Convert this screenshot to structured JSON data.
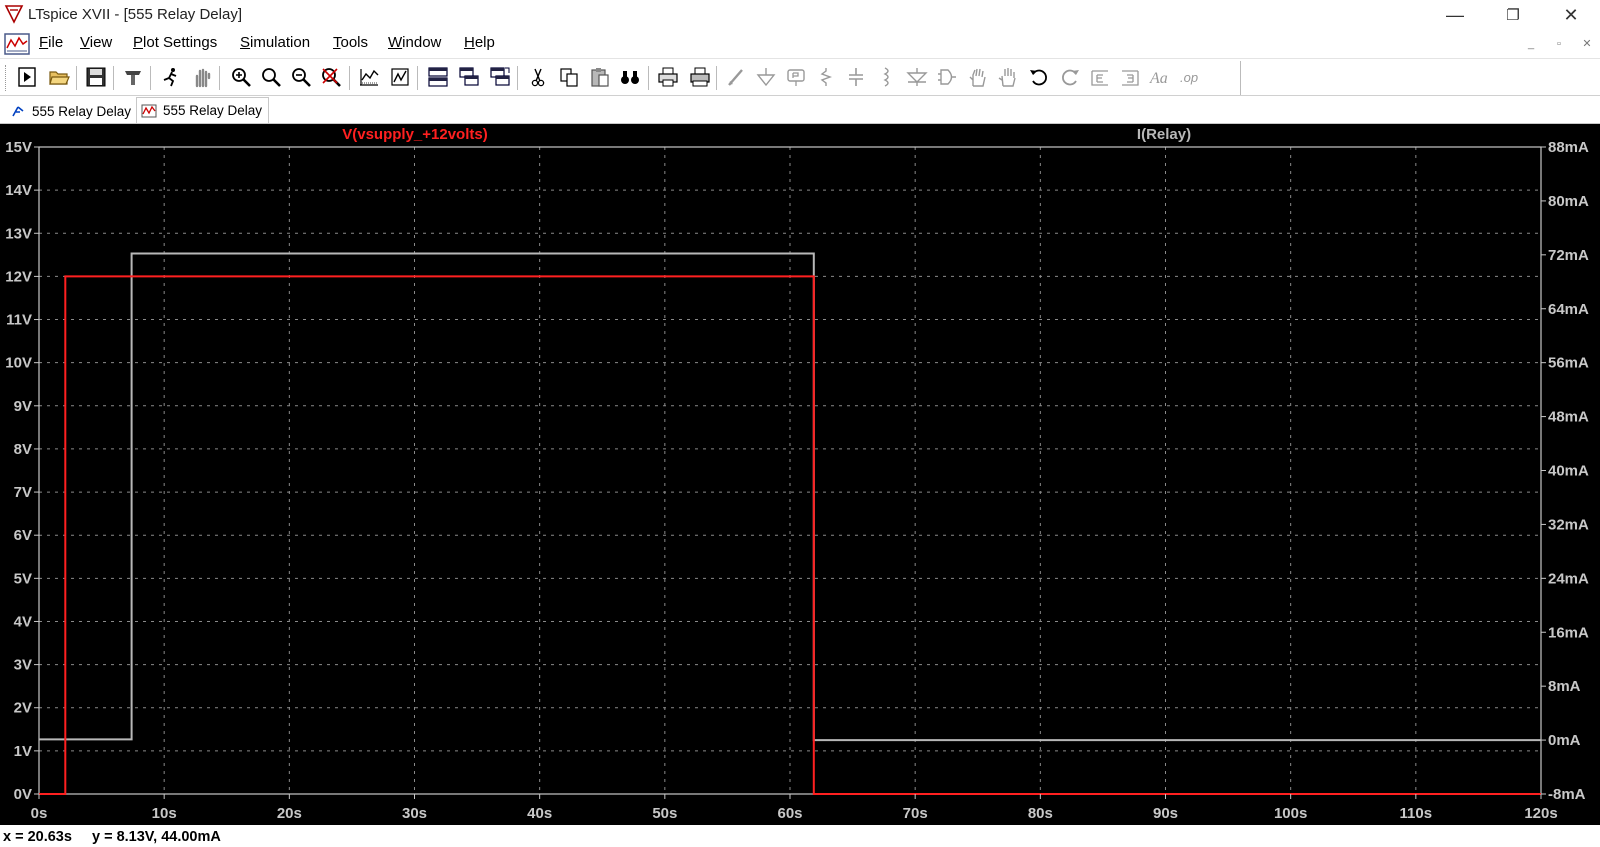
{
  "window": {
    "title": "LTspice XVII - [555 Relay Delay]",
    "controls": {
      "minimize": "—",
      "restore": "❐",
      "close": "✕"
    },
    "app_icon": "ltspice-logo-icon"
  },
  "menu": {
    "items": [
      {
        "label": "File",
        "accel": "F",
        "rest": "ile"
      },
      {
        "label": "View",
        "accel": "V",
        "rest": "iew"
      },
      {
        "label": "Plot Settings",
        "accel": "P",
        "rest": "lot Settings"
      },
      {
        "label": "Simulation",
        "accel": "S",
        "rest": "imulation"
      },
      {
        "label": "Tools",
        "accel": "T",
        "rest": "ools"
      },
      {
        "label": "Window",
        "accel": "W",
        "rest": "indow"
      },
      {
        "label": "Help",
        "accel": "H",
        "rest": "elp"
      }
    ],
    "mdi_controls": {
      "minimize": "_",
      "restore": "▫",
      "close": "✕"
    }
  },
  "toolbar": {
    "buttons": [
      "new-schematic-icon",
      "open-icon",
      "save-icon",
      "control-panel-icon",
      "run-icon",
      "halt-icon",
      "zoom-in-icon",
      "zoom-fit-icon",
      "zoom-out-icon",
      "zoom-cancel-icon",
      "autorange-icon",
      "grid-icon",
      "tile-horizontal-icon",
      "cascade-icon",
      "tile-vertical-icon",
      "cut-icon",
      "copy-icon",
      "paste-icon",
      "find-icon",
      "print-icon",
      "print-setup-icon",
      "wire-icon",
      "ground-icon",
      "label-icon",
      "resistor-icon",
      "capacitor-icon",
      "inductor-icon",
      "diode-icon",
      "component-icon",
      "move-icon",
      "drag-icon",
      "undo-icon",
      "redo-icon",
      "rotate-icon",
      "mirror-icon",
      "text-icon",
      "spice-directive-icon"
    ]
  },
  "tabs": [
    {
      "label": "555 Relay Delay",
      "icon": "schematic-icon",
      "active": false
    },
    {
      "label": "555 Relay Delay",
      "icon": "waveform-icon",
      "active": true
    }
  ],
  "plot": {
    "trace_labels": {
      "left": "V(vsupply_+12volts)",
      "right": "I(Relay)"
    },
    "colors": {
      "background": "#000000",
      "grid": "#8a8a8a",
      "axis_text": "#c8c8c8",
      "trace_voltage": "#ff2020",
      "trace_current": "#b8b8b8",
      "label_left": "#ff2020",
      "label_right": "#b8b8b8"
    }
  },
  "chart_data": {
    "type": "line",
    "x_axis": {
      "label": "",
      "range": [
        0,
        120
      ],
      "unit": "s",
      "ticks": [
        "0s",
        "10s",
        "20s",
        "30s",
        "40s",
        "50s",
        "60s",
        "70s",
        "80s",
        "90s",
        "100s",
        "110s",
        "120s"
      ]
    },
    "y_left": {
      "range": [
        0,
        15
      ],
      "unit": "V",
      "ticks": [
        "0V",
        "1V",
        "2V",
        "3V",
        "4V",
        "5V",
        "6V",
        "7V",
        "8V",
        "9V",
        "10V",
        "11V",
        "12V",
        "13V",
        "14V",
        "15V"
      ]
    },
    "y_right": {
      "range": [
        -8,
        88
      ],
      "unit": "mA",
      "ticks": [
        "-8mA",
        "0mA",
        "8mA",
        "16mA",
        "24mA",
        "32mA",
        "40mA",
        "48mA",
        "56mA",
        "64mA",
        "72mA",
        "80mA",
        "88mA"
      ]
    },
    "grid": true,
    "series": [
      {
        "name": "V(vsupply_+12volts)",
        "axis": "left",
        "x": [
          0,
          2.1,
          2.1,
          61.9,
          61.9,
          120
        ],
        "y": [
          0,
          0,
          12,
          12,
          0,
          0
        ]
      },
      {
        "name": "I(Relay)",
        "axis": "right",
        "x": [
          0,
          2.1,
          2.1,
          7.4,
          7.4,
          61.9,
          61.9,
          120
        ],
        "y": [
          0.1,
          0.1,
          0.1,
          0.1,
          72.2,
          72.2,
          0.0,
          0.0
        ]
      }
    ]
  },
  "status": {
    "x_readout": "x = 20.63s",
    "y_readout": "y = 8.13V, 44.00mA"
  }
}
